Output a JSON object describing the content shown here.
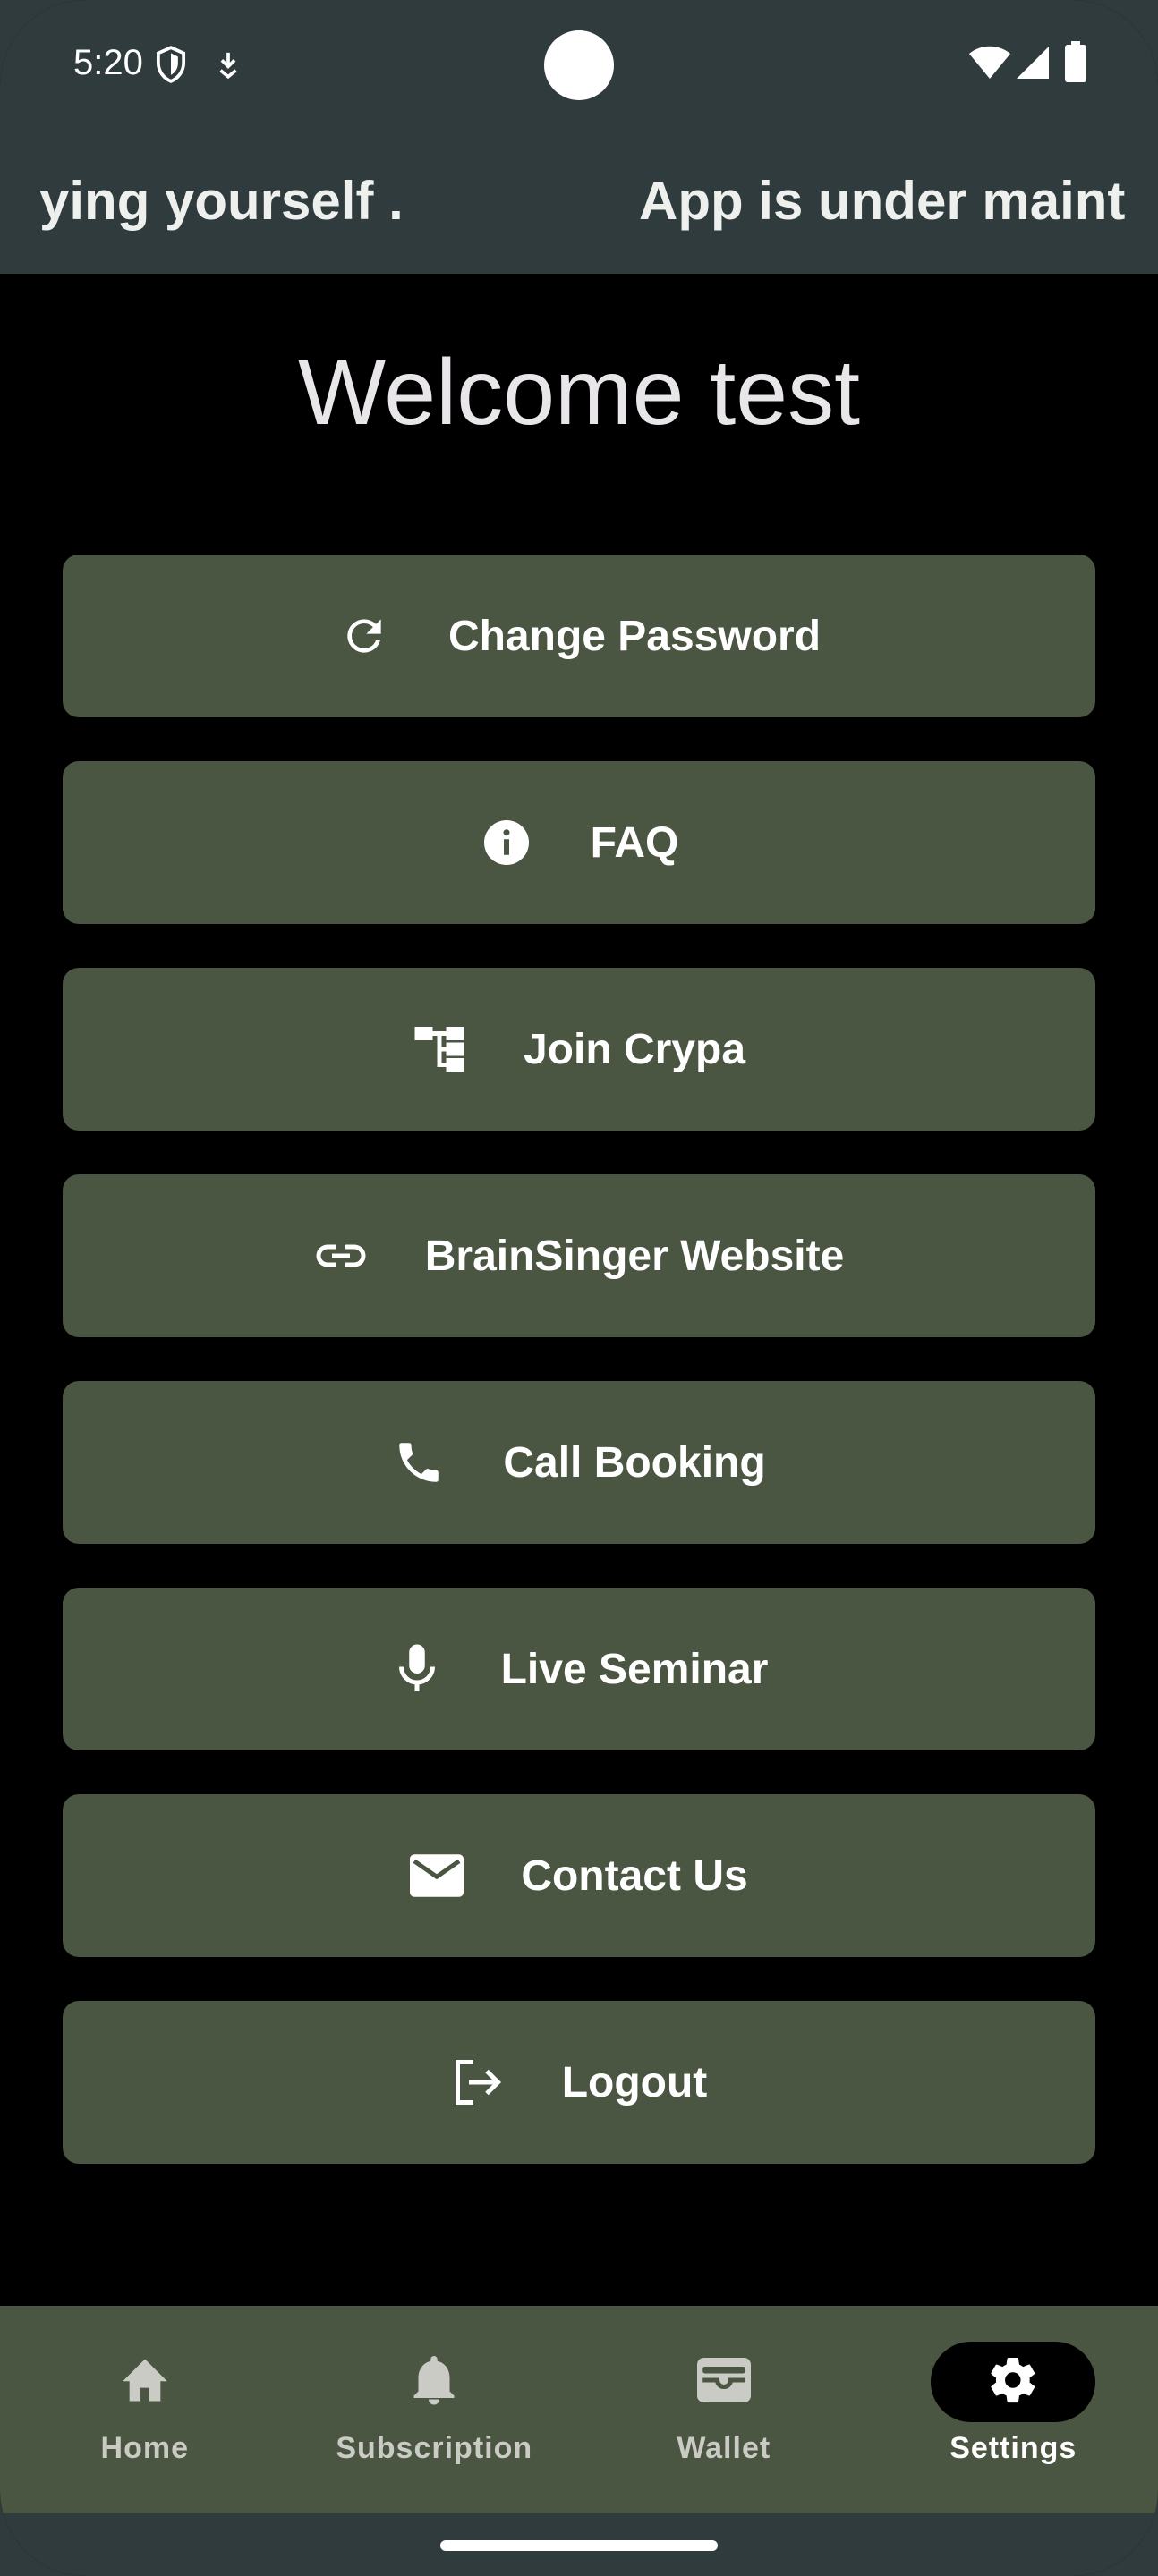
{
  "status_bar": {
    "time": "5:20",
    "icons": [
      "shield-icon",
      "download-arrow-icon",
      "wifi-icon",
      "signal-icon",
      "battery-icon"
    ]
  },
  "marquee": {
    "text_left": "ying yourself .",
    "text_right": "App is under maint"
  },
  "welcome": {
    "title": "Welcome test"
  },
  "menu": {
    "items": [
      {
        "label": "Change Password",
        "icon": "refresh-icon"
      },
      {
        "label": "FAQ",
        "icon": "info-icon"
      },
      {
        "label": "Join Crypa",
        "icon": "hierarchy-icon"
      },
      {
        "label": "BrainSinger Website",
        "icon": "link-icon"
      },
      {
        "label": "Call Booking",
        "icon": "phone-icon"
      },
      {
        "label": "Live Seminar",
        "icon": "microphone-icon"
      },
      {
        "label": "Contact Us",
        "icon": "mail-icon"
      },
      {
        "label": "Logout",
        "icon": "logout-icon"
      }
    ]
  },
  "bottom_nav": {
    "items": [
      {
        "label": "Home",
        "icon": "home-icon",
        "active": false
      },
      {
        "label": "Subscription",
        "icon": "bell-icon",
        "active": false
      },
      {
        "label": "Wallet",
        "icon": "wallet-icon",
        "active": false
      },
      {
        "label": "Settings",
        "icon": "gear-icon",
        "active": true
      }
    ]
  },
  "colors": {
    "bar_background": "#2f3b3c",
    "button_background": "#4a5641",
    "page_background": "#000000",
    "text": "#ffffff"
  }
}
